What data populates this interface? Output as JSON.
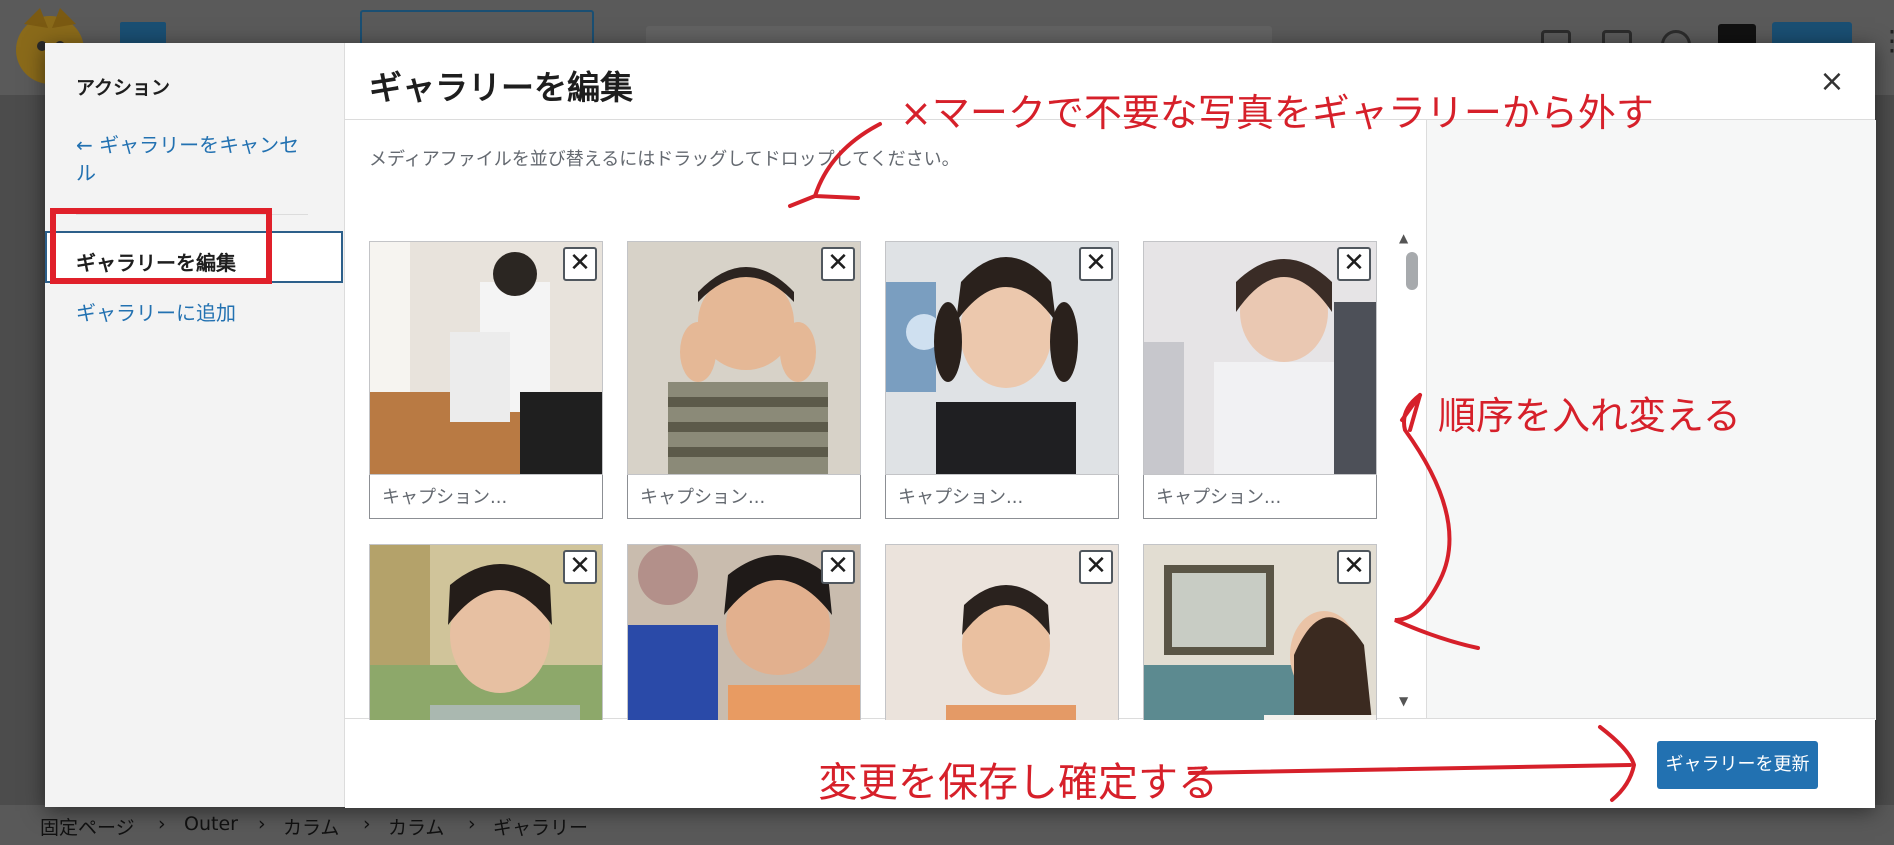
{
  "app": {
    "breadcrumb": [
      "固定ページ",
      "Outer",
      "カラム",
      "カラム",
      "ギャラリー"
    ]
  },
  "modal": {
    "sidebar": {
      "heading": "アクション",
      "cancel_label": "← ギャラリーをキャンセル",
      "edit_label": "ギャラリーを編集",
      "add_label": "ギャラリーに追加"
    },
    "title": "ギャラリーを編集",
    "close_glyph": "×",
    "instructions": "メディアファイルを並び替えるにはドラッグしてドロップしてください。",
    "remove_glyph": "✕",
    "caption_placeholder": "キャプション...",
    "update_button": "ギャラリーを更新"
  },
  "annotations": {
    "remove_note": "×マークで不要な写真をギャラリーから外す",
    "reorder_note": "順序を入れ変える",
    "save_note": "変更を保存し確定する"
  },
  "colors": {
    "accent": "#2271b1",
    "annotation_red": "#d6202a",
    "sidebar_bg": "#f3f3f3"
  },
  "tiles": [
    {
      "photo": "child-jumping"
    },
    {
      "photo": "boy-peace-sign"
    },
    {
      "photo": "girl-pigtails"
    },
    {
      "photo": "girl-smiling-hoodie"
    },
    {
      "photo": "boy-smiling-green"
    },
    {
      "photo": "boys-playing"
    },
    {
      "photo": "boy-laughing"
    },
    {
      "photo": "woman-window"
    }
  ]
}
